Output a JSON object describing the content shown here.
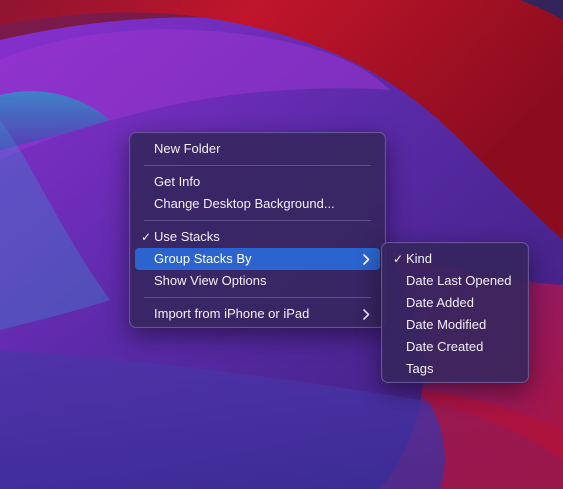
{
  "context_menu": {
    "new_folder": "New Folder",
    "get_info": "Get Info",
    "change_background": "Change Desktop Background...",
    "use_stacks": "Use Stacks",
    "use_stacks_check": "✓",
    "group_stacks_by": "Group Stacks By",
    "show_view_options": "Show View Options",
    "import_from_iphone": "Import from iPhone or iPad"
  },
  "submenu": {
    "items": [
      {
        "label": "Kind",
        "checked": true,
        "check": "✓"
      },
      {
        "label": "Date Last Opened",
        "checked": false
      },
      {
        "label": "Date Added",
        "checked": false
      },
      {
        "label": "Date Modified",
        "checked": false
      },
      {
        "label": "Date Created",
        "checked": false
      },
      {
        "label": "Tags",
        "checked": false
      }
    ]
  },
  "icons": {
    "checkmark": "checkmark-icon",
    "submenu_arrow": "chevron-right-icon"
  },
  "colors": {
    "highlight": "#2b64cf",
    "menu_background": "#34265c",
    "wallpaper_red": "#b0112a",
    "wallpaper_purple": "#7a2fc4",
    "wallpaper_teal": "#2a8ec0"
  }
}
